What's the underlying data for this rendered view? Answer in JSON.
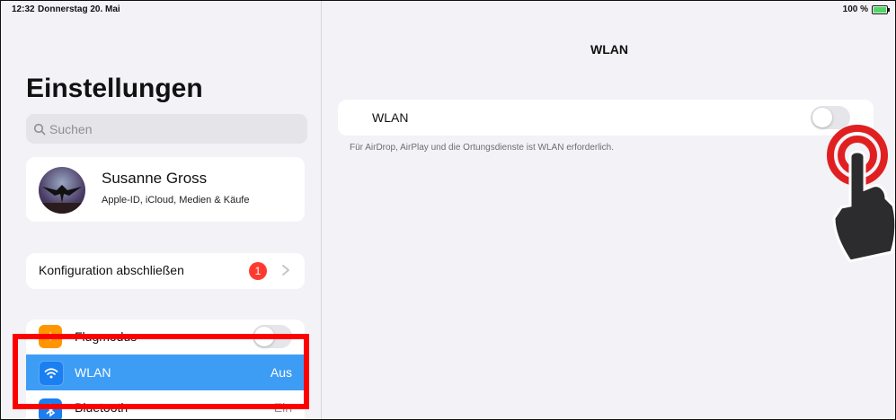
{
  "status_bar": {
    "time": "12:32",
    "date": "Donnerstag 20. Mai",
    "battery_percent": "100 %",
    "battery_level": 1.0
  },
  "sidebar": {
    "title": "Einstellungen",
    "search": {
      "placeholder": "Suchen"
    },
    "profile": {
      "name": "Susanne Gross",
      "subtitle": "Apple-ID, iCloud, Medien & Käufe"
    },
    "config": {
      "label": "Konfiguration abschließen",
      "badge": "1"
    },
    "settings": {
      "airplane": {
        "label": "Flugmodus",
        "toggle_on": false
      },
      "wlan": {
        "label": "WLAN",
        "value": "Aus",
        "selected": true
      },
      "bluetooth": {
        "label": "Bluetooth",
        "value": "Ein"
      }
    }
  },
  "detail": {
    "title": "WLAN",
    "wlan_row": {
      "label": "WLAN",
      "toggle_on": false
    },
    "footnote": "Für AirDrop, AirPlay und die Ortungsdienste ist WLAN erforderlich."
  },
  "annotations": {
    "highlight_color": "#ff0000",
    "tap_indicator_color": "#e02020"
  },
  "colors": {
    "selection": "#3d9df5",
    "badge": "#ff3b30",
    "airplane_icon_bg": "#ff9500",
    "wifi_icon_bg": "#1a7ff0"
  }
}
